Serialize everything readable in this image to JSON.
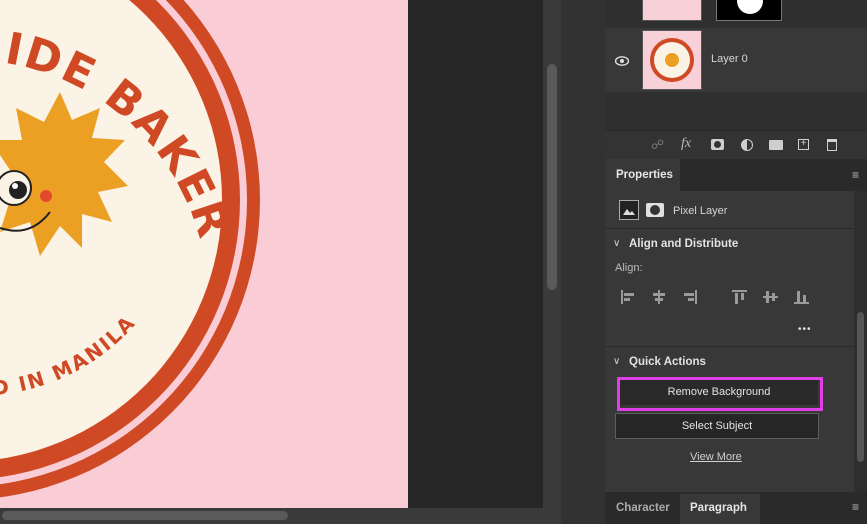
{
  "canvas": {
    "badge_top_text": "SIDE BAKER",
    "badge_bottom_text": "KED IN MANILA",
    "colors": {
      "background": "#f9ccd6",
      "ring": "#cf4a24",
      "cream": "#fbf3e6",
      "sun": "#eba024"
    }
  },
  "layers": {
    "layer0_name": "Layer 0",
    "eye_icon": "eye-icon",
    "toolbar_icons": [
      "link-icon",
      "fx-icon",
      "mask-icon",
      "adjustment-icon",
      "folder-icon",
      "new-layer-icon",
      "trash-icon"
    ],
    "fx_label": "fx"
  },
  "properties": {
    "tab_label": "Properties",
    "layer_type_label": "Pixel Layer",
    "align": {
      "section_title": "Align and Distribute",
      "align_label": "Align:",
      "more_label": "•••"
    },
    "quick_actions": {
      "section_title": "Quick Actions",
      "remove_bg_label": "Remove Background",
      "select_subject_label": "Select Subject",
      "view_more_label": "View More",
      "highlight_color": "#e13fe6"
    }
  },
  "bottom_tabs": [
    {
      "label": "Character"
    },
    {
      "label": "Paragraph"
    }
  ]
}
